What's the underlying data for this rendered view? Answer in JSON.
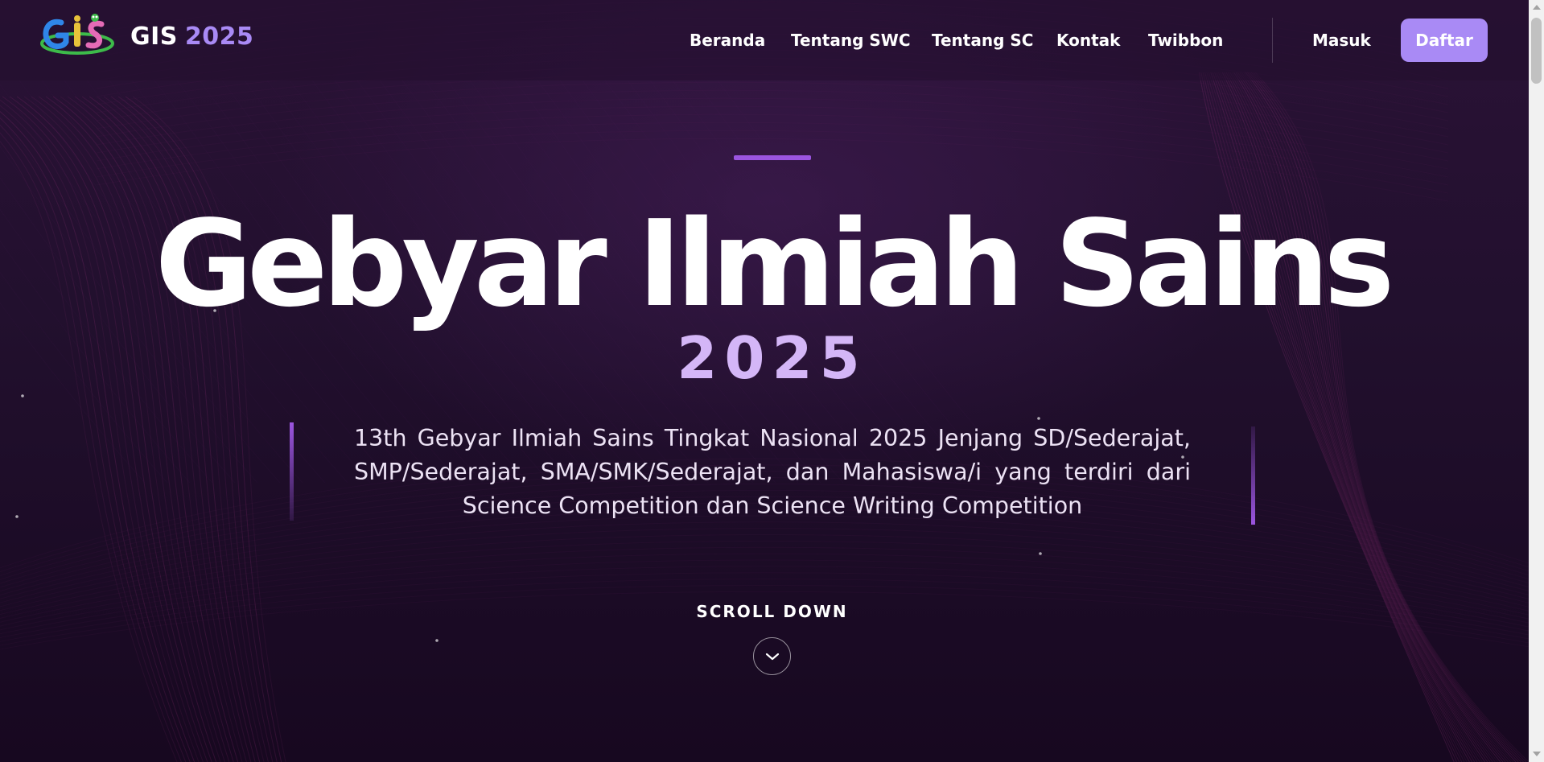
{
  "header": {
    "brand_name": "GIS",
    "brand_year": "2025",
    "nav_items": [
      "Beranda",
      "Tentang SWC",
      "Tentang SC",
      "Kontak",
      "Twibbon"
    ],
    "login_label": "Masuk",
    "register_label": "Daftar"
  },
  "hero": {
    "title": "Gebyar Ilmiah Sains",
    "year": "2025",
    "description": "13th Gebyar Ilmiah Sains Tingkat Nasional 2025 Jenjang SD/Sederajat, SMP/Sederajat, SMA/SMK/Sederajat, dan Mahasiswa/i yang terdiri dari Science Competition dan Science Writing Competition",
    "scroll_label": "SCROLL DOWN"
  },
  "colors": {
    "background": "#1a0a24",
    "accent": "#a98af5",
    "year_accent": "#d4b6f7",
    "rule_accent": "#9b55e0"
  },
  "icons": {
    "logo": "gis-logo",
    "scroll": "chevron-down-icon"
  }
}
